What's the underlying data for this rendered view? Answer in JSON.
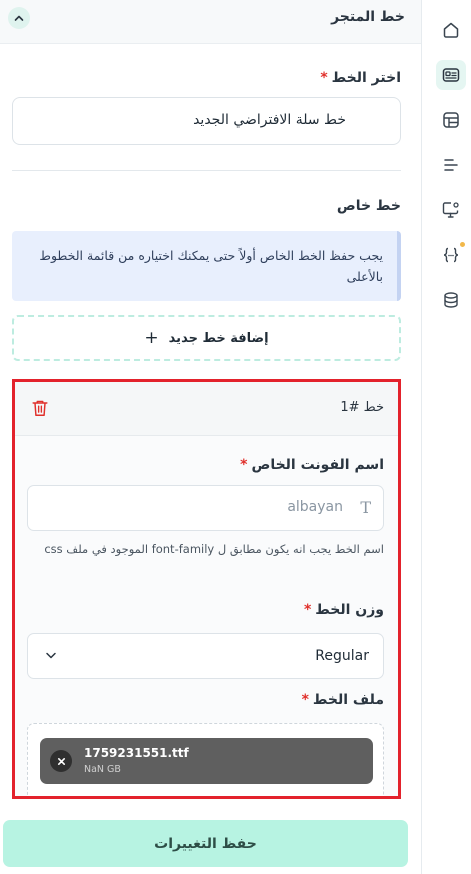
{
  "header": {
    "title": "خط المتجر"
  },
  "choose_font": {
    "label": "اختر الخط",
    "required_mark": "*",
    "selected": "خط سلة الافتراضي الجديد"
  },
  "custom_font": {
    "label": "خط خاص",
    "notice": "يجب حفظ الخط الخاص أولاً حتى يمكنك اختياره من قائمة الخطوط بالأعلى",
    "add_button": "إضافة خط جديد"
  },
  "font_card": {
    "title": "خط #1",
    "name_field": {
      "label": "اسم الفونت الخاص",
      "required_mark": "*",
      "placeholder": "albayan",
      "hint": "اسم الخط يجب انه يكون مطابق ل font-family الموجود في ملف css"
    },
    "weight_field": {
      "label": "وزن الخط",
      "required_mark": "*",
      "value": "Regular"
    },
    "file_field": {
      "label": "ملف الخط",
      "required_mark": "*",
      "file_name": "1759231551.ttf",
      "file_size": "NaN GB"
    }
  },
  "save_button": "حفظ التغييرات",
  "rail": {
    "icons": [
      "home-icon",
      "id-card-icon",
      "layout-icon",
      "menu-lines-icon",
      "settings-monitor-icon",
      "code-braces-icon",
      "database-icon"
    ],
    "active": "id-card-icon"
  },
  "colors": {
    "accent": "#e5f6f2",
    "save_button": "#b7f3e2",
    "highlight_border": "#e3222c",
    "notice_bg": "#e8effd"
  }
}
